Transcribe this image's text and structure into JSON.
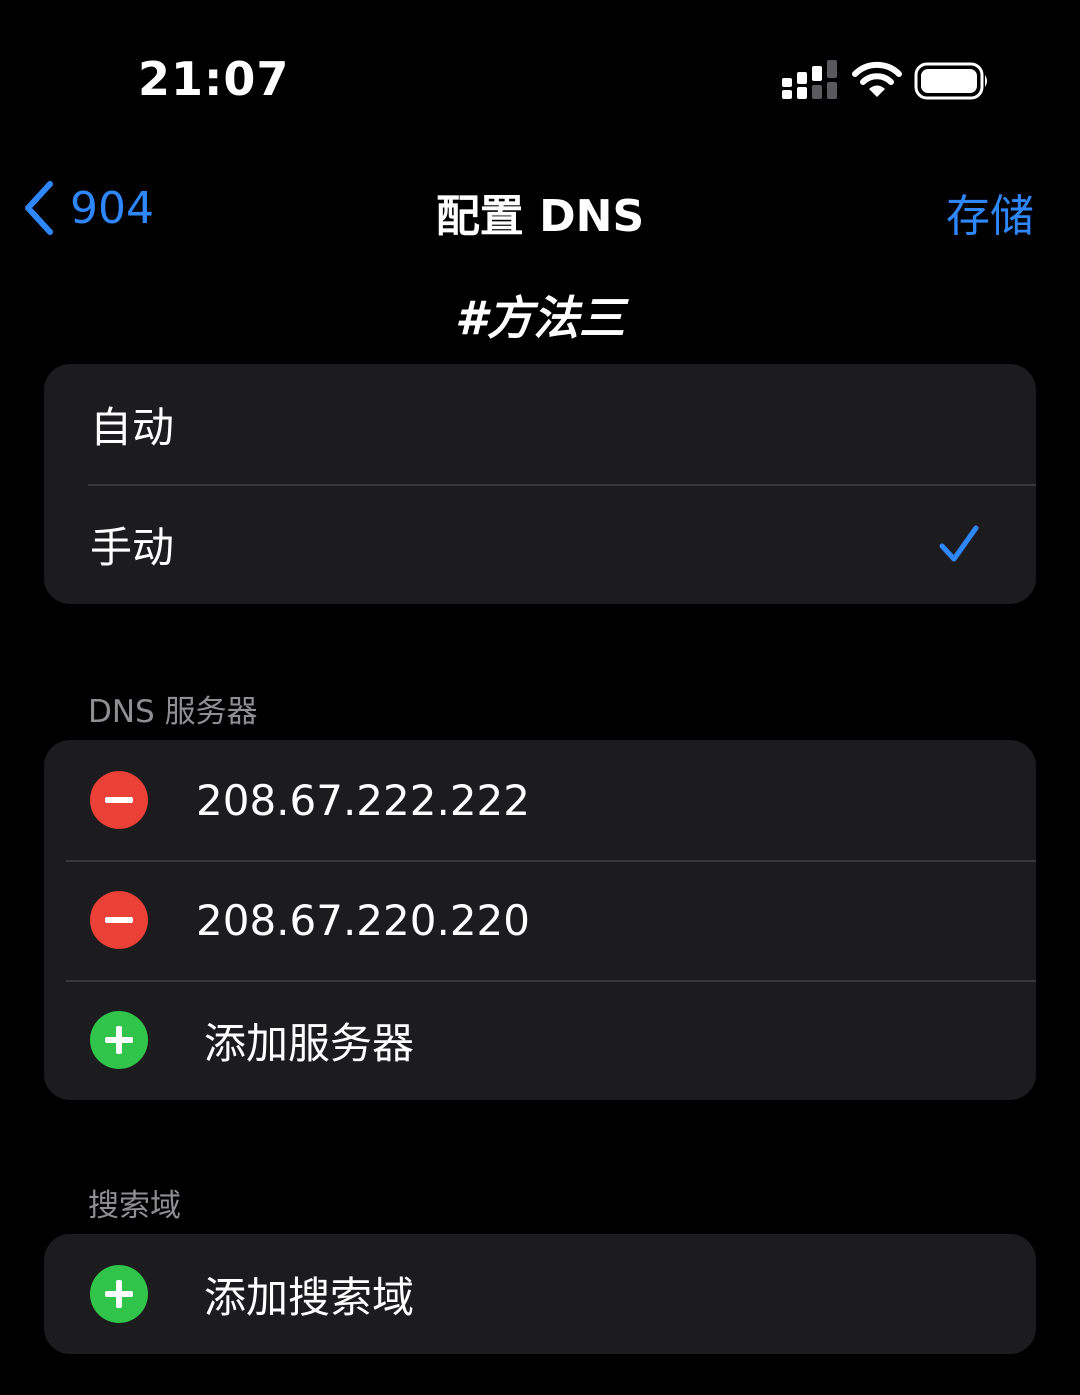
{
  "status_bar": {
    "time": "21:07"
  },
  "nav": {
    "back_label": "904",
    "title": "配置 DNS",
    "save_label": "存储"
  },
  "overlay_caption": "#方法三",
  "mode": {
    "options": [
      "自动",
      "手动"
    ],
    "selected": "手动"
  },
  "dns_section": {
    "header": "DNS 服务器",
    "servers": [
      "208.67.222.222",
      "208.67.220.220"
    ],
    "add_label": "添加服务器"
  },
  "search_section": {
    "header": "搜索域",
    "add_label": "添加搜索域"
  },
  "colors": {
    "accent": "#2f87ff",
    "delete": "#eb4036",
    "add": "#30c44a",
    "group_bg": "#1c1c1e",
    "header_text": "#8e8e93"
  }
}
